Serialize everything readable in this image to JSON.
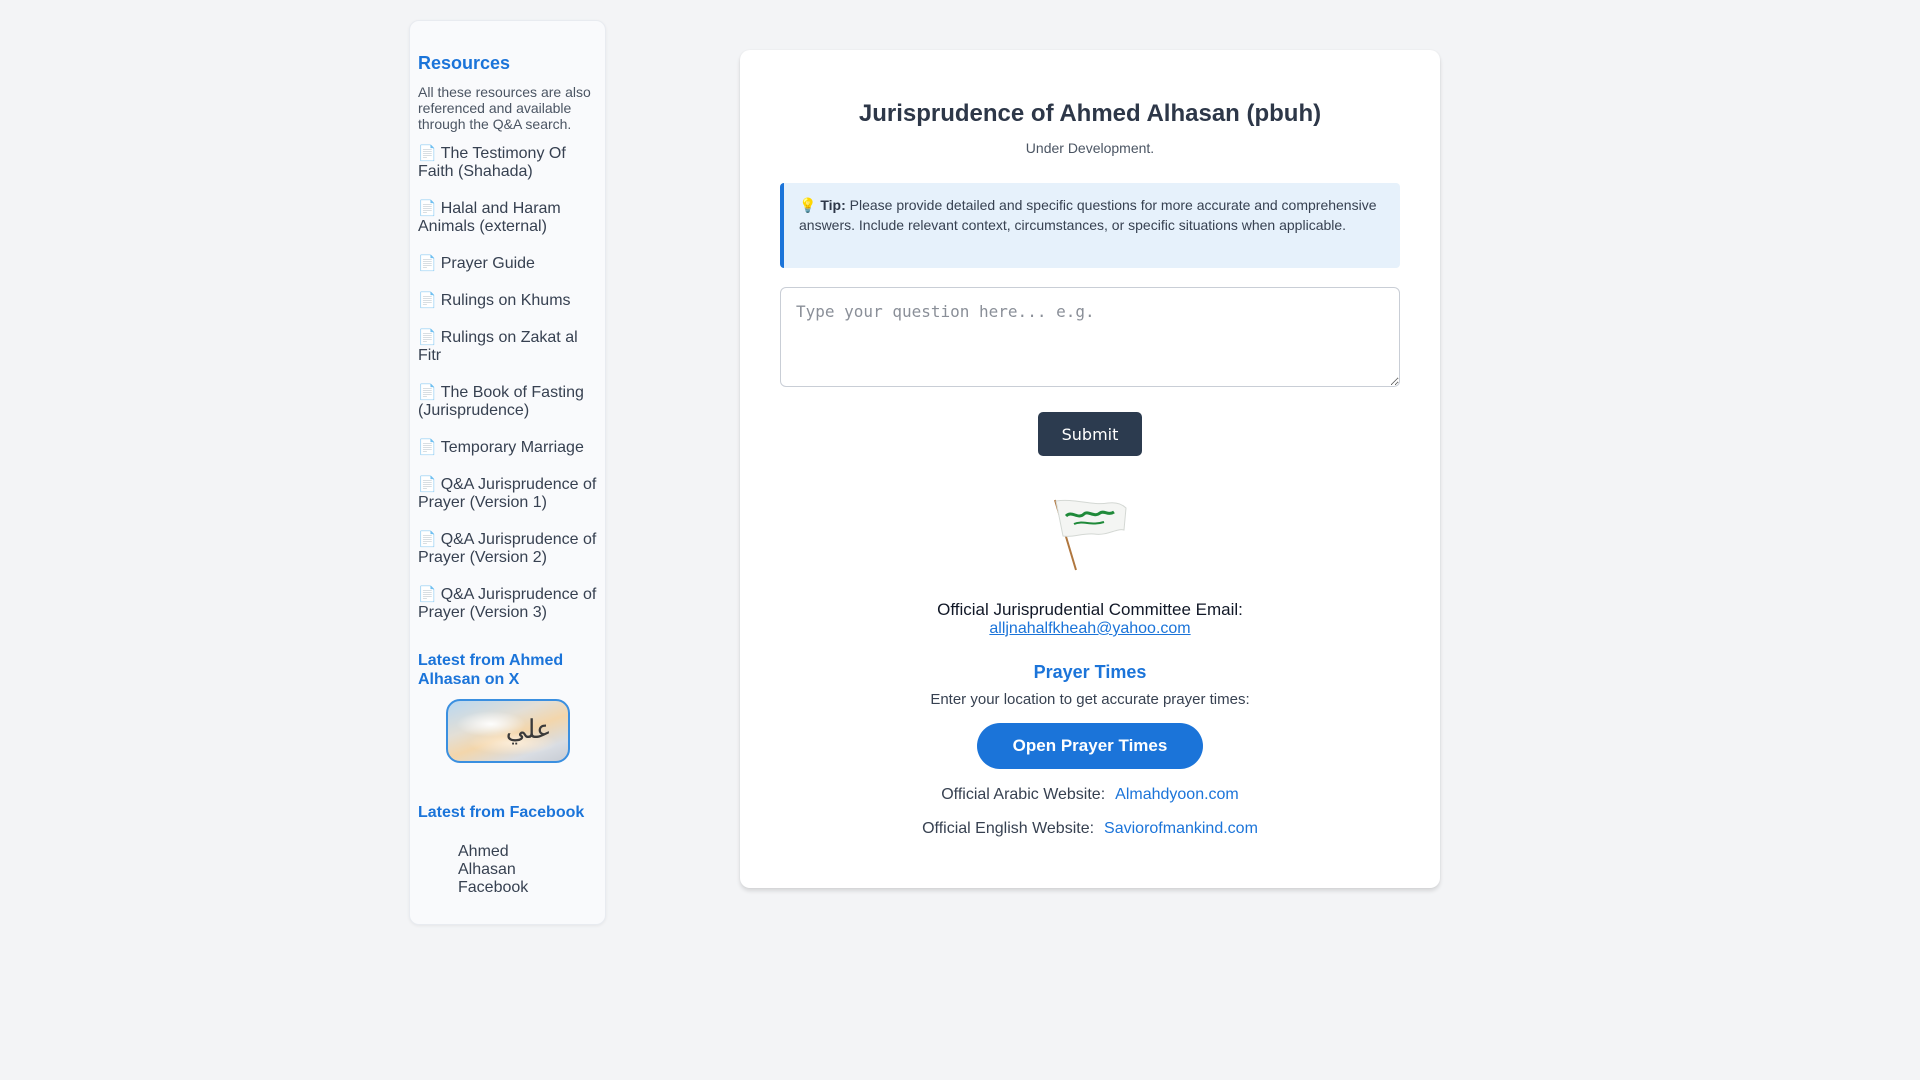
{
  "sidebar": {
    "title": "Resources",
    "description": "All these resources are also referenced and available through the Q&A search.",
    "doc_icon": "📄",
    "links": [
      {
        "label": "The Testimony Of Faith (Shahada)"
      },
      {
        "label": "Halal and Haram Animals (external)"
      },
      {
        "label": "Prayer Guide"
      },
      {
        "label": "Rulings on Khums"
      },
      {
        "label": "Rulings on Zakat al Fitr"
      },
      {
        "label": "The Book of Fasting (Jurisprudence)"
      },
      {
        "label": "Temporary Marriage"
      },
      {
        "label": "Q&A Jurisprudence of Prayer (Version 1)"
      },
      {
        "label": "Q&A Jurisprudence of Prayer (Version 2)"
      },
      {
        "label": "Q&A Jurisprudence of Prayer (Version 3)"
      }
    ],
    "x_section_title": "Latest from Ahmed Alhasan on X",
    "x_image_text": "علي",
    "facebook_section_title": "Latest from Facebook",
    "facebook_link": "Ahmed Alhasan Facebook"
  },
  "main": {
    "title": "Jurisprudence of Ahmed Alhasan (pbuh)",
    "subtitle": "Under Development.",
    "tip": {
      "icon": "💡",
      "label": "Tip:",
      "text": "Please provide detailed and specific questions for more accurate and comprehensive answers. Include relevant context, circumstances, or specific situations when applicable."
    },
    "question_placeholder": "Type your question here... e.g.",
    "submit_label": "Submit",
    "email_label": "Official Jurisprudential Committee Email:",
    "email": "alljnahalfkheah@yahoo.com",
    "prayer_times": {
      "title": "Prayer Times",
      "description": "Enter your location to get accurate prayer times:",
      "button_label": "Open Prayer Times"
    },
    "arabic_site": {
      "label": "Official Arabic Website:",
      "link": "Almahdyoon.com"
    },
    "english_site": {
      "label": "Official English Website:",
      "link": "Saviorofmankind.com"
    }
  },
  "colors": {
    "accent": "#1b74d9",
    "dark_button": "#2c3b4f",
    "background": "#f3f4f6",
    "tip_background": "#e6f1fb"
  }
}
